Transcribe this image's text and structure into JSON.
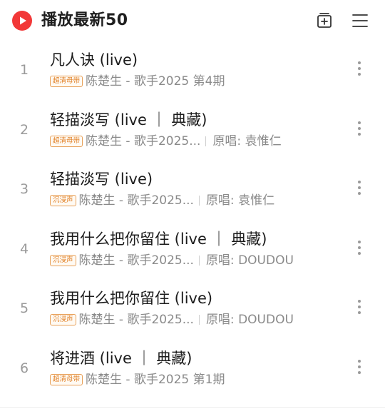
{
  "header": {
    "title": "播放最新50",
    "play_icon": "play-circle-icon",
    "add_icon": "add-to-playlist-icon",
    "menu_icon": "menu-lines-icon"
  },
  "colors": {
    "brand": "#f23838",
    "badge": "#e07f24"
  },
  "songs": [
    {
      "rank": "1",
      "title": "凡人诀 (live)",
      "badge": "超清母带",
      "artist": "陈楚生 - 歌手2025 第4期",
      "original": ""
    },
    {
      "rank": "2",
      "title": "轻描淡写 (live ｜ 典藏)",
      "badge": "超清母带",
      "artist": "陈楚生 - 歌手2025...",
      "original": "原唱: 袁惟仁"
    },
    {
      "rank": "3",
      "title": "轻描淡写 (live)",
      "badge": "沉浸声",
      "artist": "陈楚生 - 歌手2025...",
      "original": "原唱: 袁惟仁"
    },
    {
      "rank": "4",
      "title": "我用什么把你留住 (live ｜ 典藏)",
      "badge": "沉浸声",
      "artist": "陈楚生 - 歌手2025...",
      "original": "原唱: DOUDOU"
    },
    {
      "rank": "5",
      "title": "我用什么把你留住 (live)",
      "badge": "沉浸声",
      "artist": "陈楚生 - 歌手2025...",
      "original": "原唱: DOUDOU"
    },
    {
      "rank": "6",
      "title": "将进酒 (live ｜ 典藏)",
      "badge": "超清母带",
      "artist": "陈楚生 - 歌手2025 第1期",
      "original": ""
    }
  ]
}
